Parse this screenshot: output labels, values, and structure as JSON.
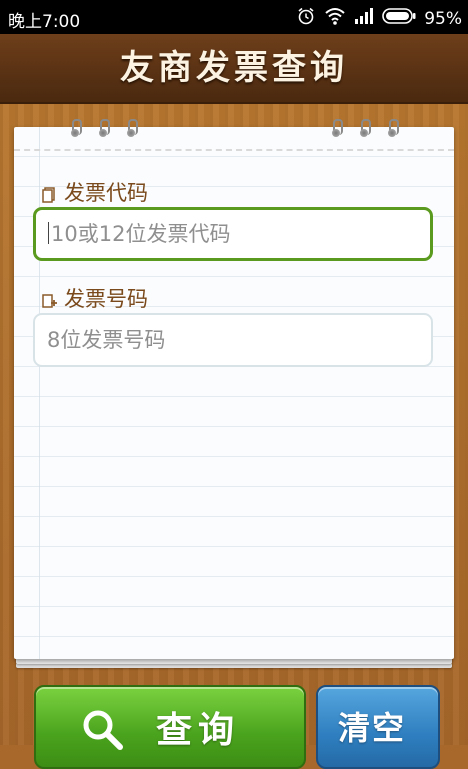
{
  "status_bar": {
    "time": "晚上7:00",
    "battery_percent": "95%",
    "icons": [
      "alarm-icon",
      "wifi-icon",
      "signal-icon",
      "battery-icon"
    ]
  },
  "header": {
    "title": "友商发票查询"
  },
  "form": {
    "invoice_code": {
      "label": "发票代码",
      "placeholder": "10或12位发票代码",
      "value": "",
      "icon": "document-icon"
    },
    "invoice_number": {
      "label": "发票号码",
      "placeholder": "8位发票号码",
      "value": "",
      "icon": "document-add-icon"
    }
  },
  "actions": {
    "query_label": "查询",
    "clear_label": "清空"
  },
  "colors": {
    "header_bg": "#5a3214",
    "wood": "#a8672b",
    "focus_border": "#5a9a1e",
    "query_button": "#4aa31d",
    "clear_button": "#2f7fc0",
    "label_text": "#7a4a1c"
  }
}
